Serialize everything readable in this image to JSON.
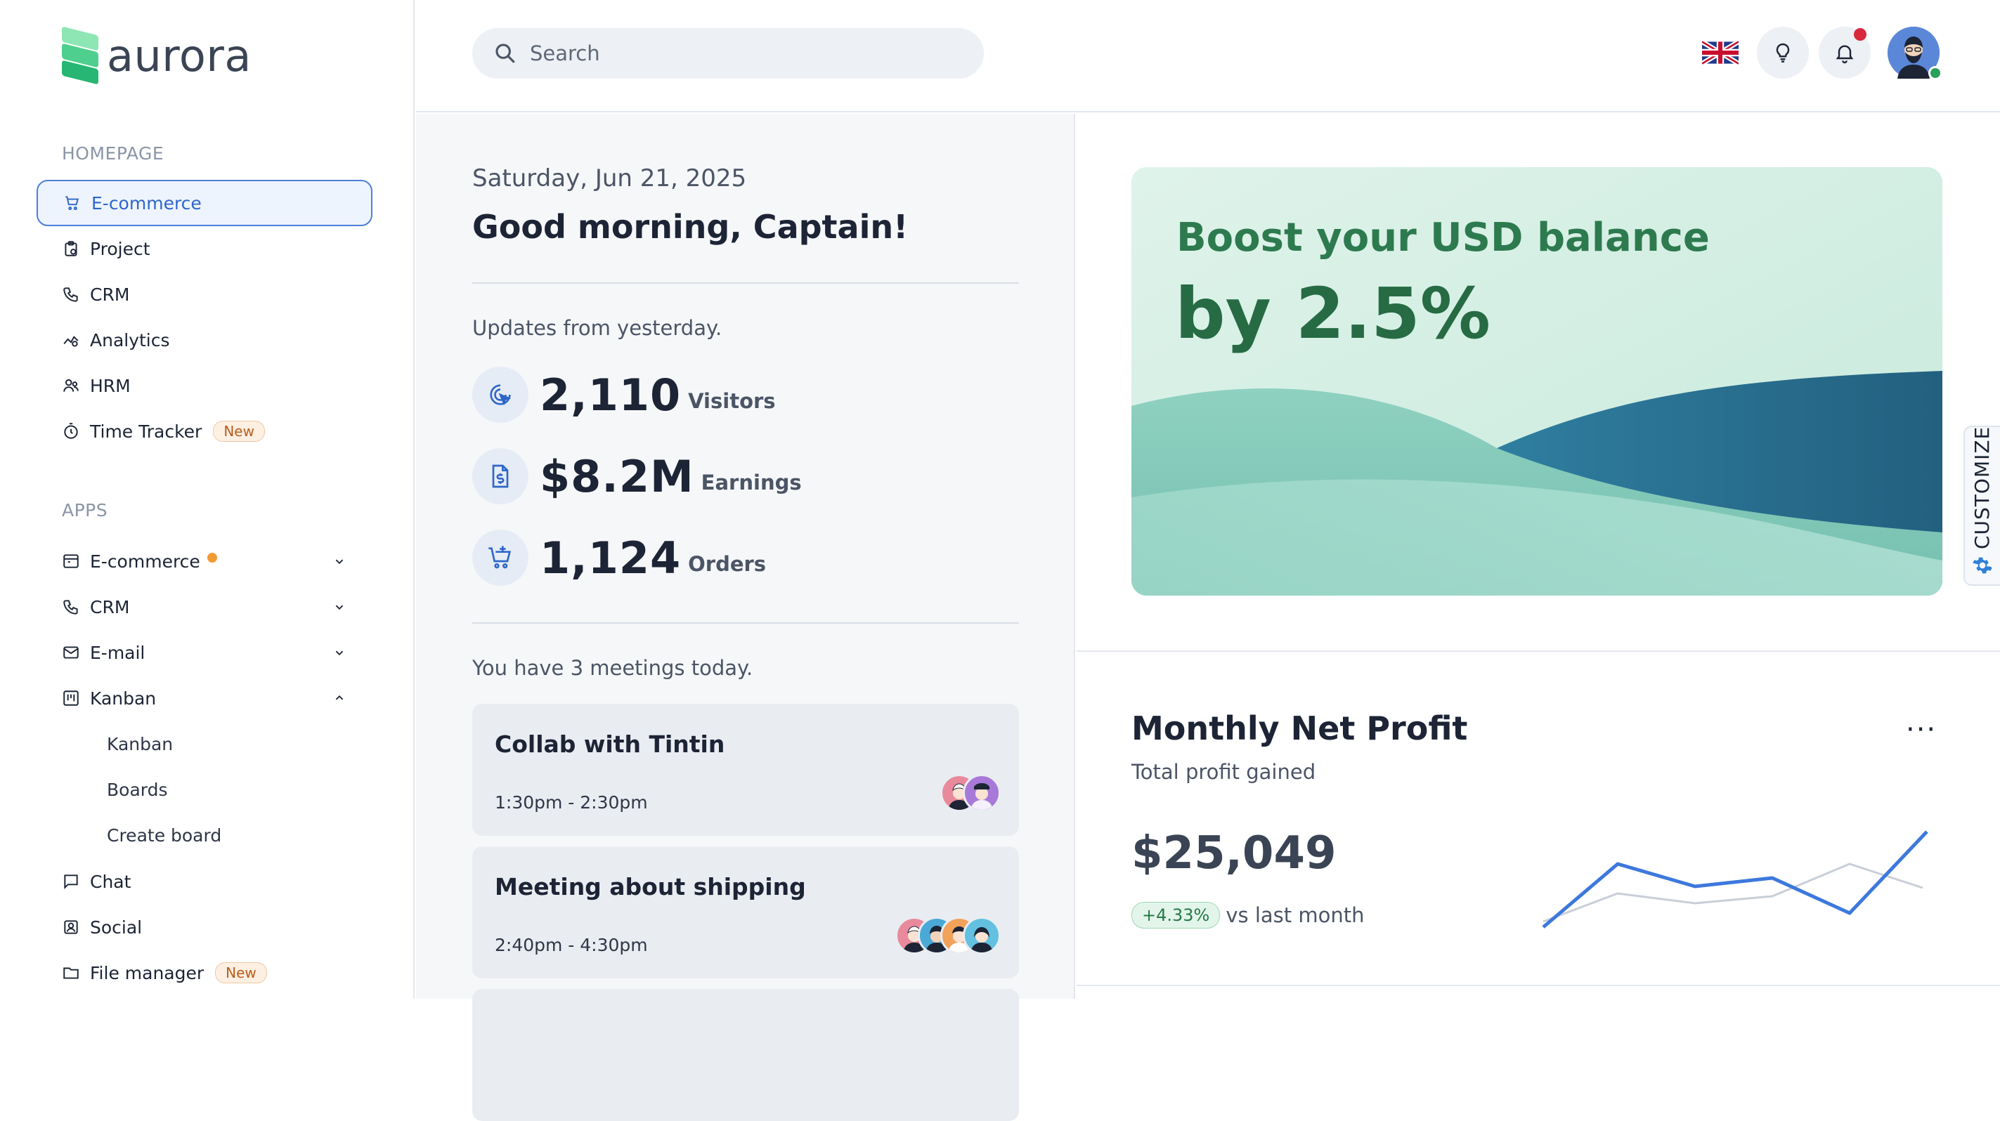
{
  "brand": {
    "name": "aurora"
  },
  "sidebar": {
    "homepage_label": "HOMEPAGE",
    "homepage_items": [
      {
        "label": "E-commerce",
        "icon": "cart-icon",
        "active": true
      },
      {
        "label": "Project",
        "icon": "clipboard-icon"
      },
      {
        "label": "CRM",
        "icon": "phone-icon"
      },
      {
        "label": "Analytics",
        "icon": "analytics-icon"
      },
      {
        "label": "HRM",
        "icon": "users-icon"
      },
      {
        "label": "Time Tracker",
        "icon": "stopwatch-icon",
        "badge": "New"
      }
    ],
    "apps_label": "APPS",
    "apps_items": [
      {
        "label": "E-commerce",
        "icon": "store-icon",
        "expanded": false
      },
      {
        "label": "CRM",
        "icon": "phone-icon",
        "expanded": false
      },
      {
        "label": "E-mail",
        "icon": "mail-icon",
        "expanded": false
      },
      {
        "label": "Kanban",
        "icon": "kanban-icon",
        "expanded": true
      },
      {
        "label": "Chat",
        "icon": "chat-icon"
      },
      {
        "label": "Social",
        "icon": "social-icon"
      },
      {
        "label": "File manager",
        "icon": "folder-icon",
        "badge": "New"
      }
    ],
    "kanban_subitems": [
      "Kanban",
      "Boards",
      "Create board"
    ]
  },
  "header": {
    "search_placeholder": "Search",
    "language_flag": "uk-flag-icon"
  },
  "overview": {
    "date": "Saturday, Jun 21, 2025",
    "greeting": "Good morning,  Captain!",
    "updates_label": "Updates from yesterday.",
    "stats": [
      {
        "value": "2,110",
        "label": "Visitors",
        "icon": "cursor-click-icon"
      },
      {
        "value": "$8.2M",
        "label": "Earnings",
        "icon": "dollar-document-icon"
      },
      {
        "value": "1,124",
        "label": "Orders",
        "icon": "cart-plus-icon"
      }
    ],
    "meetings_label": "You have 3 meetings today.",
    "meetings": [
      {
        "title": "Collab with Tintin",
        "time": "1:30pm - 2:30pm"
      },
      {
        "title": "Meeting about shipping",
        "time": "2:40pm - 4:30pm"
      }
    ]
  },
  "promo": {
    "line1": "Boost your USD balance",
    "line2": "by 2.5%"
  },
  "profit": {
    "title": "Monthly Net Profit",
    "subtitle": "Total profit gained",
    "value": "$25,049",
    "change": "+4.33%",
    "change_text": "vs last month",
    "more_label": "···"
  },
  "customize": {
    "label": "CUSTOMIZE"
  },
  "colors": {
    "accent": "#2f66c8",
    "promo_text": "#2e7a4f",
    "positive": "#257a47",
    "notification": "#d8283d"
  }
}
